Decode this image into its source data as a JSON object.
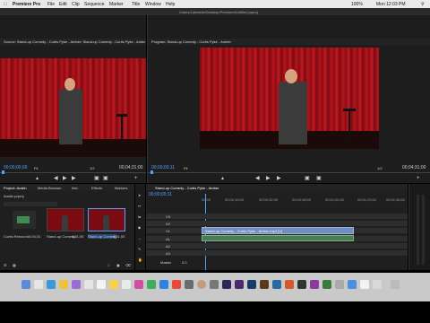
{
  "menubar": {
    "app": "Premiere Pro",
    "items": [
      "File",
      "Edit",
      "Clip",
      "Sequence",
      "Marker",
      "Title",
      "Window",
      "Help"
    ],
    "battery": "100%",
    "clock": "Mon 12:03 PM"
  },
  "path": "/Users/Lakeside/Desktop/Premiere/Untitled.prproj",
  "source_monitor": {
    "title": "Source: Stand-up Comedy - Curtis Pyke - Amber: Stand-up Comedy - Curtis Pyke - Amber",
    "timecode_left": "00;00;00;00",
    "fit": "Fit",
    "fraction": "1/2",
    "timecode_right": "00;04;31;00"
  },
  "program_monitor": {
    "title": "Program: Stand-up Comedy - Curtis Pyke - Amber",
    "timecode_left": "00;00;00;11",
    "fit": "Fit",
    "fraction": "1/2",
    "timecode_right": "00;04;31;00"
  },
  "project_panel": {
    "tabs": [
      "Project: Austin",
      "Media Browser",
      "Info",
      "Effects",
      "Markers"
    ],
    "name": "Austin.prproj",
    "items": [
      {
        "label": "Curtis Rebound",
        "dur": "0;04;31"
      },
      {
        "label": "Stand-up Comedy",
        "dur": "4;31;00"
      },
      {
        "label": "Stand-up Comedy",
        "dur": "4;31;00"
      }
    ]
  },
  "timeline": {
    "title": "Stand-up Comedy - Curtis Pyke - Amber",
    "timecode": "00;00;00;11",
    "ruler": [
      "00;00",
      "00;00;16;00",
      "00;00;32;00",
      "00;00;48;00",
      "00;01;04;02",
      "00;01;20;02",
      "00;01;36;02"
    ],
    "tracks": [
      "V3",
      "V2",
      "V1",
      "A1",
      "A2",
      "A3"
    ],
    "clip_label": "Stand-up Comedy - Curtis Pyke - Amber.mp4 [V]",
    "master": "Master",
    "master_val": "0.0"
  }
}
